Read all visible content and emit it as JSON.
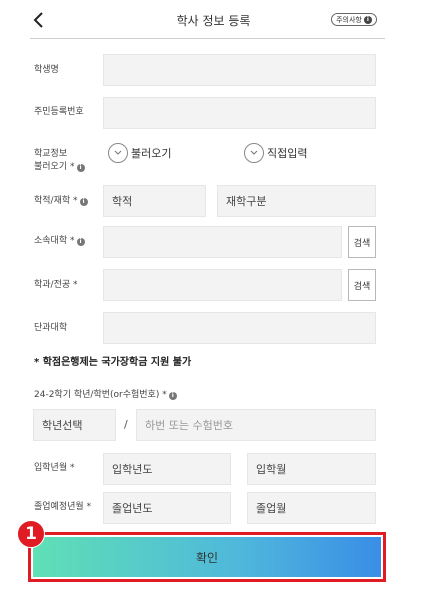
{
  "header": {
    "title": "학사 정보 등록",
    "notice_label": "주의사항",
    "notice_icon": "info-icon",
    "back_icon": "back-arrow-icon"
  },
  "form": {
    "student_name": {
      "label": "학생명",
      "value": ""
    },
    "resident_number": {
      "label": "주민등록번호",
      "value": ""
    },
    "school_info": {
      "label_line1": "학교정보",
      "label_line2": "불러오기",
      "required_mark": "*",
      "option_load": "불러오기",
      "option_direct": "직접입력",
      "radio_icon": "chevron-down-icon"
    },
    "enrollment": {
      "label": "학적/재학",
      "required_mark": "*",
      "status_placeholder": "학적",
      "enrolled_placeholder": "재학구분"
    },
    "university": {
      "label": "소속대학",
      "required_mark": "*",
      "value": "",
      "search_label": "검색"
    },
    "department": {
      "label": "학과/전공",
      "required_mark": "*",
      "value": "",
      "search_label": "검색"
    },
    "college": {
      "label": "단과대학",
      "value": ""
    },
    "warning": "* 학점은행제는 국가장학금 지원 불가",
    "grade": {
      "label": "24-2학기 학년/학번(or수험번호)",
      "required_mark": "*",
      "grade_placeholder": "학년선택",
      "slash": "/",
      "number_placeholder": "하번 또는 수험번호"
    },
    "admission": {
      "label": "입학년월",
      "required_mark": "*",
      "year_placeholder": "입학년도",
      "month_placeholder": "입학월"
    },
    "graduation": {
      "label": "졸업예정년월",
      "required_mark": "*",
      "year_placeholder": "졸업년도",
      "month_placeholder": "졸업월"
    }
  },
  "confirm_label": "확인",
  "step_badge": "1",
  "colors": {
    "accent_red": "#e01b24",
    "gradient_start": "#5fe0b5",
    "gradient_end": "#3a8de6",
    "field_bg": "#f3f3f3"
  }
}
